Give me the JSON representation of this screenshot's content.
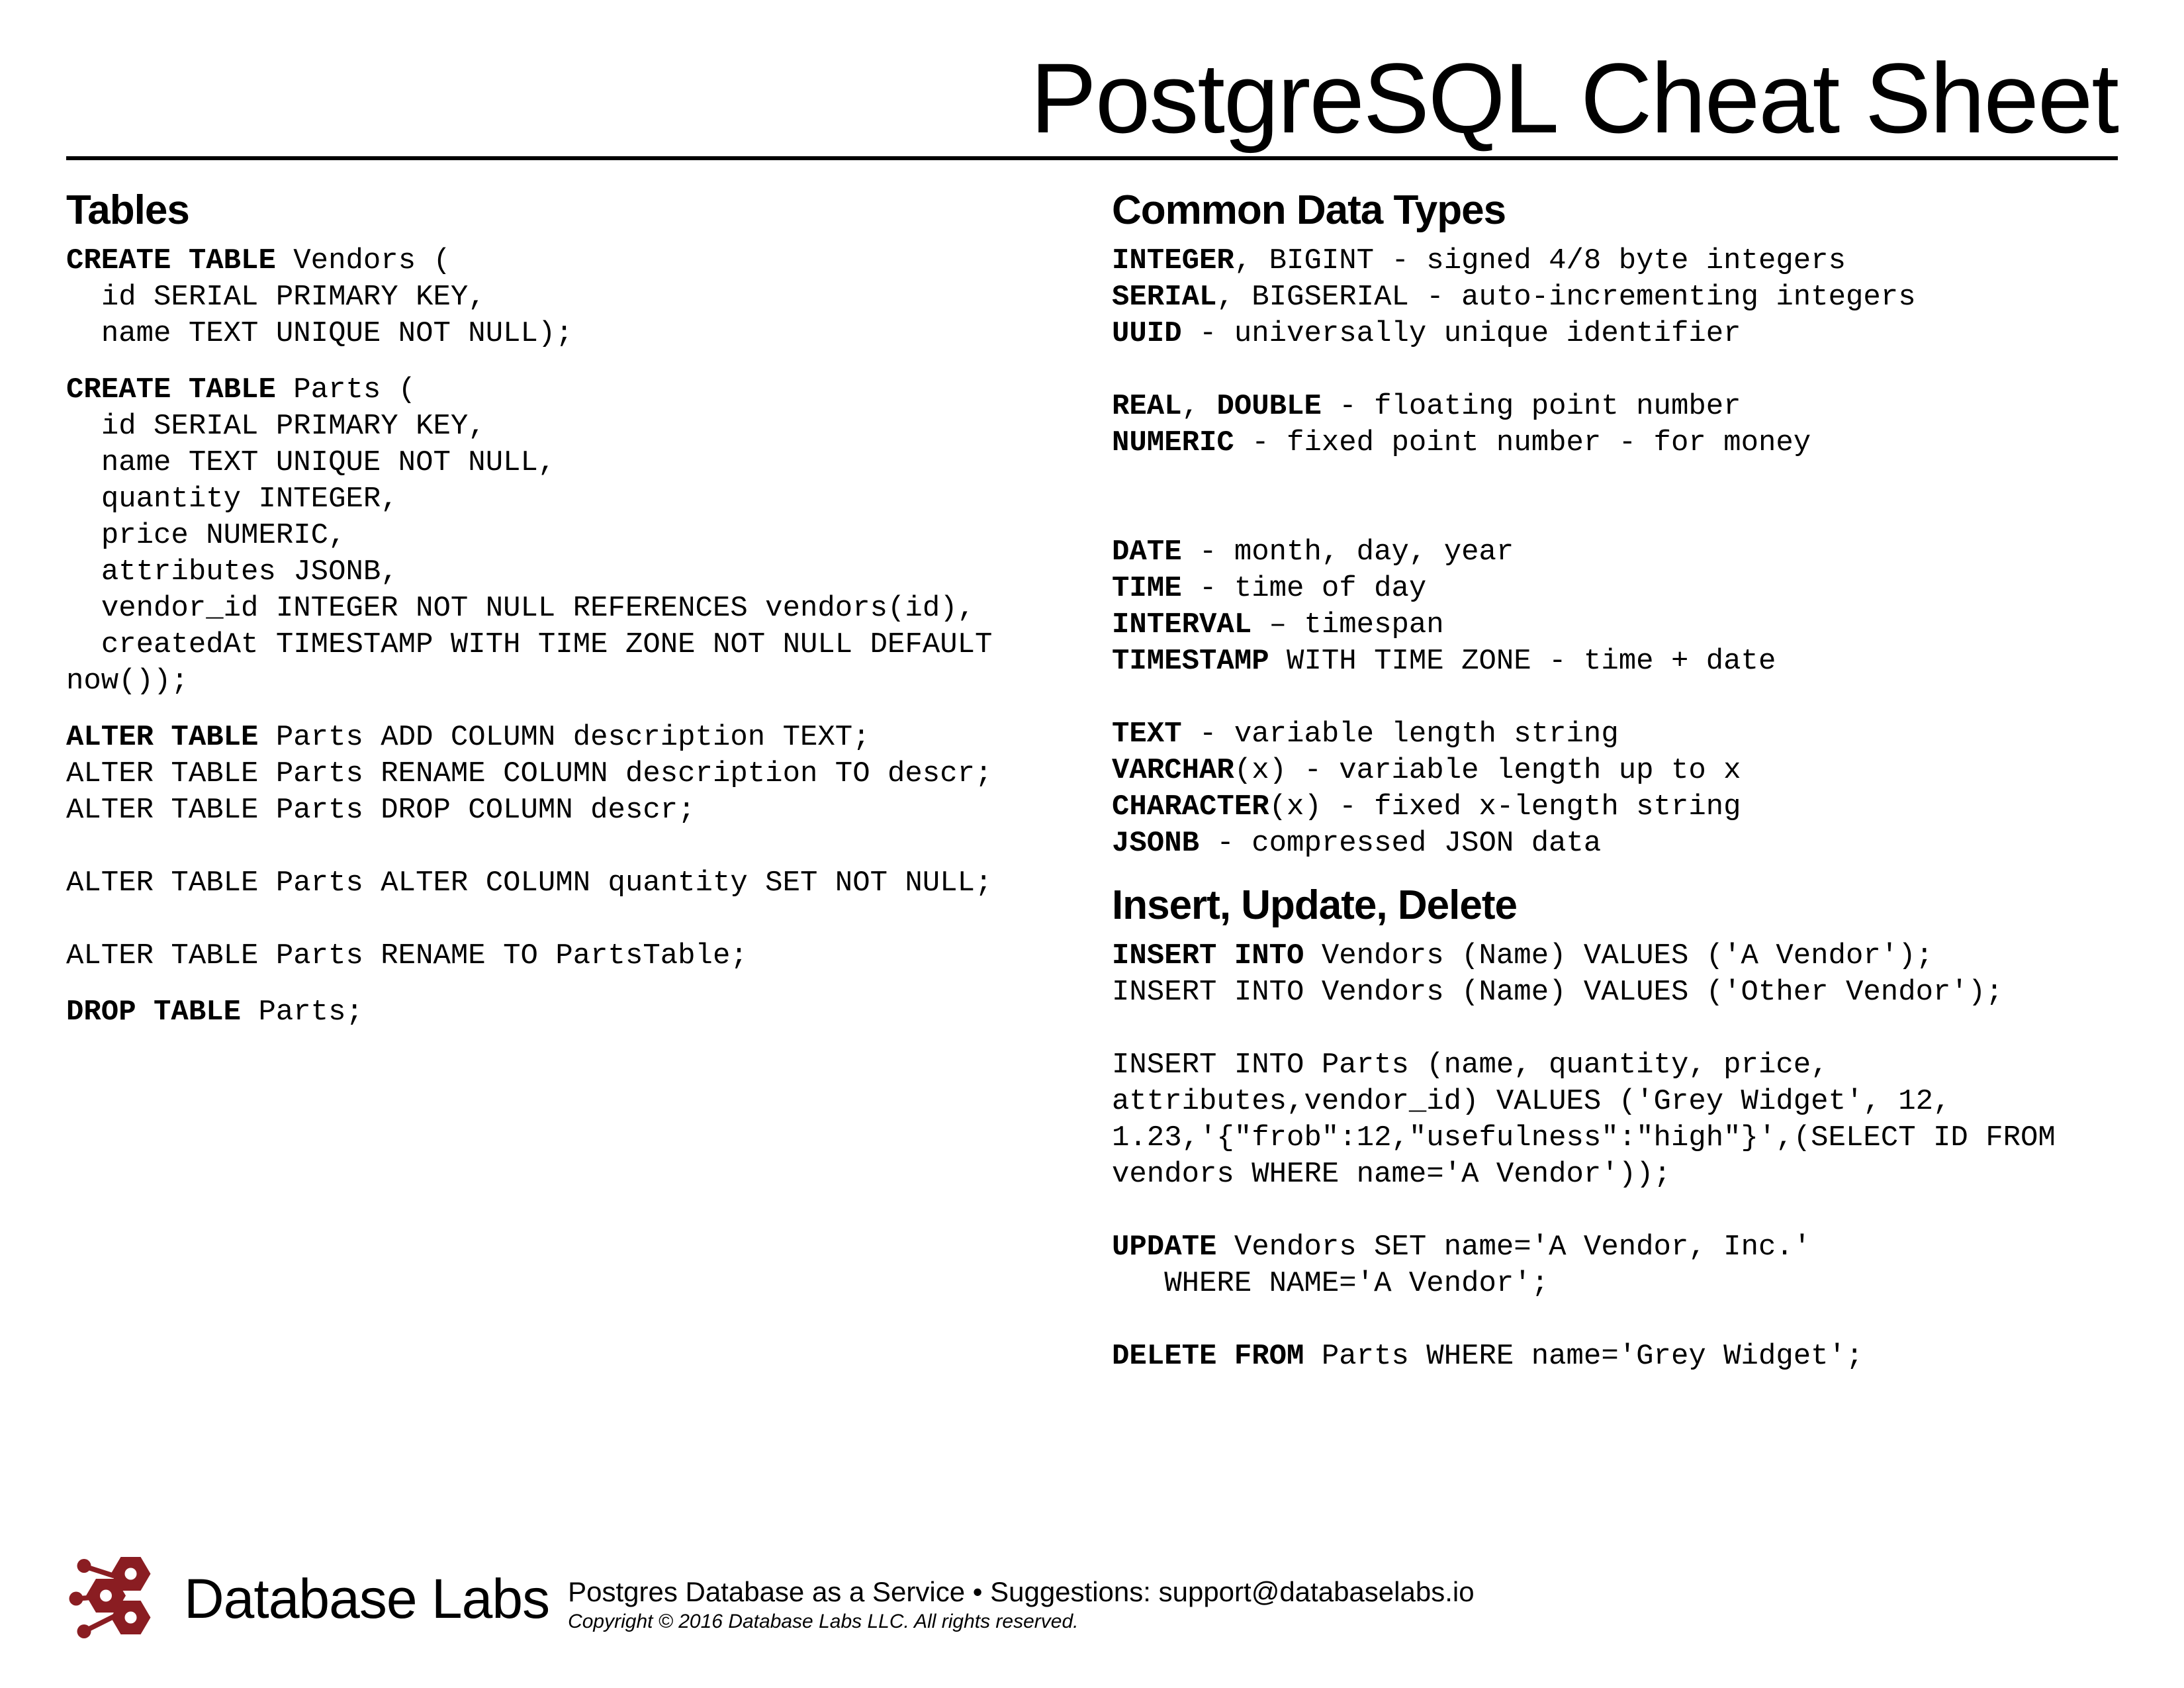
{
  "title": "PostgreSQL Cheat Sheet",
  "left": {
    "tables_heading": "Tables",
    "create_vendors": "<b>CREATE TABLE</b> Vendors (\n  id SERIAL PRIMARY KEY,\n  name TEXT UNIQUE NOT NULL);",
    "create_parts": "<b>CREATE TABLE</b> Parts (\n  id SERIAL PRIMARY KEY,\n  name TEXT UNIQUE NOT NULL,\n  quantity INTEGER,\n  price NUMERIC,\n  attributes JSONB,\n  vendor_id INTEGER NOT NULL REFERENCES vendors(id),\n  createdAt TIMESTAMP WITH TIME ZONE NOT NULL DEFAULT now());",
    "alter_block": "<b>ALTER TABLE</b> Parts ADD COLUMN description TEXT;\nALTER TABLE Parts RENAME COLUMN description TO descr;\nALTER TABLE Parts DROP COLUMN descr;\n\nALTER TABLE Parts ALTER COLUMN quantity SET NOT NULL;\n\nALTER TABLE Parts RENAME TO PartsTable;",
    "drop_block": "<b>DROP TABLE</b> Parts;"
  },
  "right": {
    "types_heading": "Common Data Types",
    "types_block": "<b>INTEGER</b>, BIGINT - signed 4/8 byte integers\n<b>SERIAL</b>, BIGSERIAL - auto-incrementing integers\n<b>UUID</b> - universally unique identifier\n\n<b>REAL</b>, <b>DOUBLE</b> - floating point number\n<b>NUMERIC</b> - fixed point number - for money\n\n\n<b>DATE</b> - month, day, year\n<b>TIME</b> - time of day\n<b>INTERVAL</b> – timespan\n<b>TIMESTAMP</b> WITH TIME ZONE - time + date\n\n<b>TEXT</b> - variable length string\n<b>VARCHAR</b>(x) - variable length up to x\n<b>CHARACTER</b>(x) - fixed x-length string\n<b>JSONB</b> - compressed JSON data",
    "iud_heading": "Insert, Update, Delete",
    "iud_block": "<b>INSERT INTO</b> Vendors (Name) VALUES ('A Vendor');\nINSERT INTO Vendors (Name) VALUES ('Other Vendor');\n\nINSERT INTO Parts (name, quantity, price, attributes,vendor_id) VALUES ('Grey Widget', 12, 1.23,'{\"frob\":12,\"usefulness\":\"high\"}',(SELECT ID FROM vendors WHERE name='A Vendor'));\n\n<b>UPDATE</b> Vendors SET name='A Vendor, Inc.'\n   WHERE NAME='A Vendor';\n\n<b>DELETE FROM</b> Parts WHERE name='Grey Widget';"
  },
  "footer": {
    "logo_text": "Database Labs",
    "tagline": "Postgres Database as a Service  •  Suggestions: support@databaselabs.io",
    "copyright": "Copyright © 2016 Database Labs LLC. All rights reserved."
  }
}
